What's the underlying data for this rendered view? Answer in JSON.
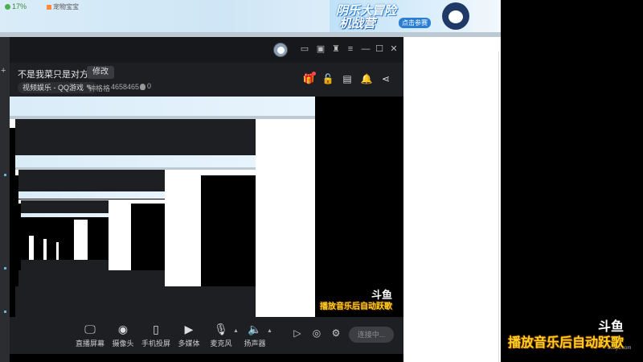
{
  "desktop": {
    "rate_text": "17%",
    "pet_text": "宠物宝宝",
    "banner": {
      "line1": "阴乐大冒险",
      "line2": "机战营",
      "cta": "点击参赛"
    }
  },
  "window": {
    "title_icons": [
      "avatar",
      "screen-icon",
      "monitor-icon",
      "shirt-icon",
      "menu-icon",
      "minimize-icon",
      "maximize-icon",
      "close-icon"
    ],
    "room": {
      "title": "不是我菜只是对方太强",
      "edit_label": "修改",
      "category": "视频娱乐 - QQ游戏",
      "streamer": "钟格格",
      "room_id": "4658465",
      "heat": "0"
    },
    "right_icons": [
      "gift-icon",
      "lock-icon",
      "layout-icon",
      "bell-icon",
      "share-icon"
    ]
  },
  "preview": {
    "watermark": "斗鱼",
    "caption": "播放音乐后自动跃歌"
  },
  "toolbar": {
    "tools": [
      {
        "name": "screen-share",
        "label": "直播屏幕",
        "icon": "🖵"
      },
      {
        "name": "camera",
        "label": "摄像头",
        "icon": "◉"
      },
      {
        "name": "phone-cast",
        "label": "手机投屏",
        "icon": "▯"
      },
      {
        "name": "media",
        "label": "多媒体",
        "icon": "▶"
      },
      {
        "name": "mic",
        "label": "麦克风",
        "icon": "🎙"
      },
      {
        "name": "speaker",
        "label": "扬声器",
        "icon": "🔈"
      }
    ],
    "go_live_label": "连接中..."
  },
  "overlay": {
    "caption": "播放音乐后自动跃歌",
    "watermark": "斗鱼",
    "watermark_sub": "douyu.com"
  }
}
